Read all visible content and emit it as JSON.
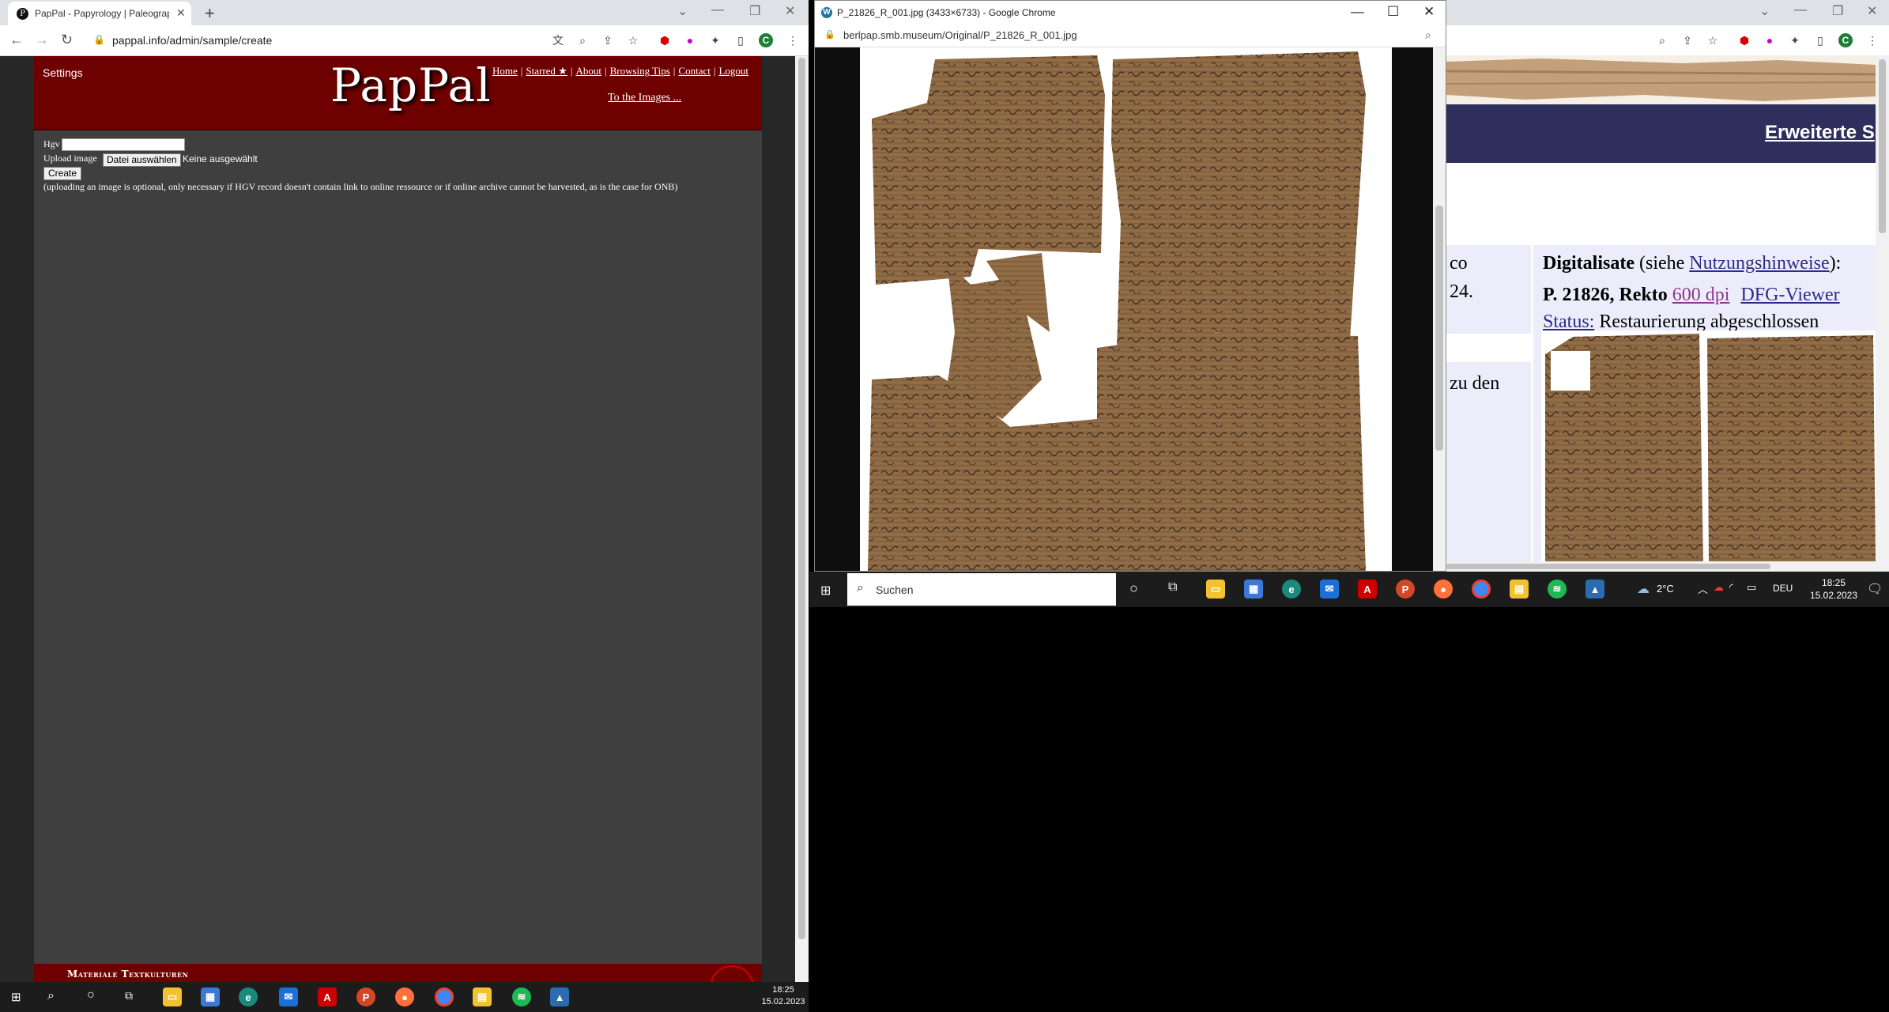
{
  "left_window": {
    "tab_title": "PapPal - Papyrology | Paleograph",
    "url": "pappal.info/admin/sample/create",
    "profile_initial": "C",
    "page": {
      "settings": "Settings",
      "logo": "PapPal",
      "nav": [
        "Home",
        "Starred ★",
        "About",
        "Browsing Tips",
        "Contact",
        "Logout"
      ],
      "to_images": "To the Images ...",
      "form": {
        "hgv_label": "Hgv",
        "hgv_value": "",
        "upload_label": "Upload image",
        "file_button": "Datei auswählen",
        "file_status": "Keine ausgewählt",
        "create_button": "Create",
        "note": "(uploading an image is optional, only necessary if HGV record doesn't contain link to online ressource or if online archive cannot be harvested, as is the case for ONB)"
      },
      "footer_text": "Materiale Textkulturen"
    }
  },
  "popup_window": {
    "title": "P_21826_R_001.jpg (3433×6733) - Google Chrome",
    "url": "berlpap.smb.museum/Original/P_21826_R_001.jpg"
  },
  "right_window": {
    "profile_initial": "C",
    "nav_link": "Erweiterte S",
    "left_col": {
      "line1": "co",
      "line2": "24.",
      "line3": "zu den"
    },
    "digitalisate_label": "Digitalisate",
    "siehe_pre": " (siehe ",
    "nutzung_link": "Nutzungshinweise",
    "siehe_post": "):",
    "record_label": "P. 21826, Rekto",
    "dpi_link": "600 dpi",
    "dfg_link": "DFG-Viewer",
    "status_label": "Status:",
    "status_value": "Restaurierung abgeschlossen"
  },
  "taskbar_main": {
    "search_placeholder": "Suchen",
    "temperature": "2°C",
    "language": "DEU",
    "time": "18:25",
    "date": "15.02.2023",
    "apps": [
      "file-explorer",
      "store",
      "edge",
      "mail",
      "acrobat",
      "powerpoint",
      "firefox",
      "chrome",
      "file-manager",
      "spotify",
      "photos"
    ]
  },
  "taskbar_secondary": {
    "time": "18:25",
    "date": "15.02.2023"
  },
  "colors": {
    "header_red": "#6e0000",
    "page_gray": "#3f3f3f",
    "nav_blue": "#2f2f5e",
    "papyrus": "#8e6a45"
  }
}
